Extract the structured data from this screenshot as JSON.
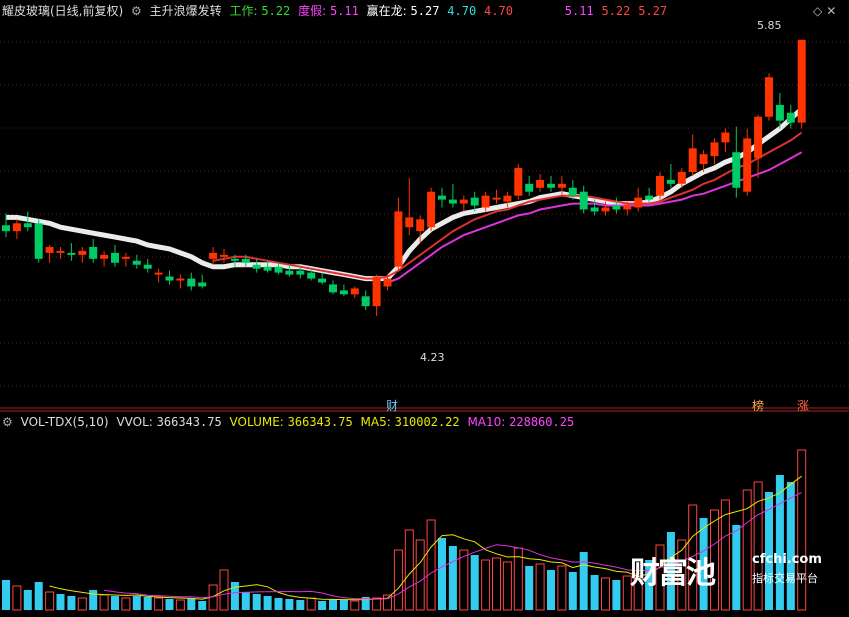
{
  "header": {
    "stock_name": "耀皮玻璃(日线,前复权)",
    "indicator_name": "主升浪爆发转",
    "gongzuo_label": "工作:",
    "gongzuo_value": "5.22",
    "duyi_label": "度假:",
    "duyi_value": "5.11",
    "yingzailong_label": "赢在龙:",
    "yingzailong_values": [
      "5.27",
      "4.70",
      "4.70"
    ],
    "extra_values": [
      "5.11",
      "5.22",
      "5.27"
    ]
  },
  "vol_header": {
    "indicator": "VOL-TDX(5,10)",
    "vvol_label": "VVOL:",
    "vvol_value": "366343.75",
    "volume_label": "VOLUME:",
    "volume_value": "366343.75",
    "ma5_label": "MA5:",
    "ma5_value": "310002.22",
    "ma10_label": "MA10:",
    "ma10_value": "228860.25"
  },
  "annotations": {
    "high_price": "5.85",
    "low_price": "4.23",
    "cai_marker": "财",
    "bang_marker": "榜",
    "zhang_marker": "涨"
  },
  "watermark": {
    "brand": "财富池",
    "site": "cfchi.com",
    "tagline": "指标交易平台"
  },
  "colors": {
    "up": "#ff3300",
    "down": "#00cc66",
    "ma_white": "#ffffff",
    "ma_red": "#e03030",
    "ma_magenta": "#dd33dd",
    "ma_yellow": "#e8e800",
    "vol_up": "#ff4444",
    "vol_down": "#33ccee",
    "bg": "#000000"
  },
  "chart_data": {
    "type": "candlestick",
    "y_range": [
      4.05,
      5.95
    ],
    "candles": [
      {
        "o": 4.91,
        "h": 4.97,
        "l": 4.85,
        "c": 4.88
      },
      {
        "o": 4.88,
        "h": 4.94,
        "l": 4.84,
        "c": 4.92
      },
      {
        "o": 4.92,
        "h": 4.98,
        "l": 4.88,
        "c": 4.9
      },
      {
        "o": 4.92,
        "h": 4.94,
        "l": 4.72,
        "c": 4.74
      },
      {
        "o": 4.77,
        "h": 4.81,
        "l": 4.72,
        "c": 4.8
      },
      {
        "o": 4.77,
        "h": 4.8,
        "l": 4.74,
        "c": 4.78
      },
      {
        "o": 4.77,
        "h": 4.82,
        "l": 4.73,
        "c": 4.76
      },
      {
        "o": 4.76,
        "h": 4.8,
        "l": 4.72,
        "c": 4.78
      },
      {
        "o": 4.8,
        "h": 4.84,
        "l": 4.72,
        "c": 4.74
      },
      {
        "o": 4.74,
        "h": 4.78,
        "l": 4.7,
        "c": 4.76
      },
      {
        "o": 4.77,
        "h": 4.81,
        "l": 4.7,
        "c": 4.72
      },
      {
        "o": 4.74,
        "h": 4.77,
        "l": 4.7,
        "c": 4.75
      },
      {
        "o": 4.73,
        "h": 4.76,
        "l": 4.69,
        "c": 4.71
      },
      {
        "o": 4.71,
        "h": 4.74,
        "l": 4.67,
        "c": 4.69
      },
      {
        "o": 4.66,
        "h": 4.69,
        "l": 4.62,
        "c": 4.67
      },
      {
        "o": 4.65,
        "h": 4.68,
        "l": 4.61,
        "c": 4.63
      },
      {
        "o": 4.63,
        "h": 4.66,
        "l": 4.59,
        "c": 4.64
      },
      {
        "o": 4.64,
        "h": 4.67,
        "l": 4.58,
        "c": 4.6
      },
      {
        "o": 4.62,
        "h": 4.66,
        "l": 4.59,
        "c": 4.6
      },
      {
        "o": 4.74,
        "h": 4.8,
        "l": 4.71,
        "c": 4.77
      },
      {
        "o": 4.75,
        "h": 4.79,
        "l": 4.72,
        "c": 4.76
      },
      {
        "o": 4.74,
        "h": 4.76,
        "l": 4.7,
        "c": 4.73
      },
      {
        "o": 4.74,
        "h": 4.76,
        "l": 4.7,
        "c": 4.72
      },
      {
        "o": 4.71,
        "h": 4.74,
        "l": 4.67,
        "c": 4.69
      },
      {
        "o": 4.7,
        "h": 4.73,
        "l": 4.67,
        "c": 4.68
      },
      {
        "o": 4.7,
        "h": 4.72,
        "l": 4.66,
        "c": 4.67
      },
      {
        "o": 4.68,
        "h": 4.71,
        "l": 4.65,
        "c": 4.66
      },
      {
        "o": 4.68,
        "h": 4.7,
        "l": 4.64,
        "c": 4.66
      },
      {
        "o": 4.67,
        "h": 4.69,
        "l": 4.63,
        "c": 4.64
      },
      {
        "o": 4.64,
        "h": 4.67,
        "l": 4.61,
        "c": 4.62
      },
      {
        "o": 4.61,
        "h": 4.63,
        "l": 4.56,
        "c": 4.57
      },
      {
        "o": 4.58,
        "h": 4.61,
        "l": 4.55,
        "c": 4.56
      },
      {
        "o": 4.56,
        "h": 4.6,
        "l": 4.54,
        "c": 4.59
      },
      {
        "o": 4.55,
        "h": 4.58,
        "l": 4.48,
        "c": 4.5
      },
      {
        "o": 4.5,
        "h": 4.66,
        "l": 4.45,
        "c": 4.65
      },
      {
        "o": 4.6,
        "h": 4.66,
        "l": 4.58,
        "c": 4.64
      },
      {
        "o": 4.7,
        "h": 5.05,
        "l": 4.68,
        "c": 4.98
      },
      {
        "o": 4.9,
        "h": 5.15,
        "l": 4.86,
        "c": 4.95
      },
      {
        "o": 4.88,
        "h": 4.96,
        "l": 4.82,
        "c": 4.94
      },
      {
        "o": 4.9,
        "h": 5.1,
        "l": 4.88,
        "c": 5.08
      },
      {
        "o": 5.06,
        "h": 5.1,
        "l": 5.0,
        "c": 5.04
      },
      {
        "o": 5.04,
        "h": 5.12,
        "l": 5.0,
        "c": 5.02
      },
      {
        "o": 5.02,
        "h": 5.06,
        "l": 4.98,
        "c": 5.04
      },
      {
        "o": 5.05,
        "h": 5.08,
        "l": 4.98,
        "c": 5.01
      },
      {
        "o": 5.0,
        "h": 5.08,
        "l": 4.98,
        "c": 5.06
      },
      {
        "o": 5.04,
        "h": 5.09,
        "l": 5.02,
        "c": 5.05
      },
      {
        "o": 5.03,
        "h": 5.08,
        "l": 5.0,
        "c": 5.06
      },
      {
        "o": 5.06,
        "h": 5.22,
        "l": 5.04,
        "c": 5.2
      },
      {
        "o": 5.12,
        "h": 5.16,
        "l": 5.06,
        "c": 5.08
      },
      {
        "o": 5.1,
        "h": 5.17,
        "l": 5.08,
        "c": 5.14
      },
      {
        "o": 5.12,
        "h": 5.16,
        "l": 5.08,
        "c": 5.1
      },
      {
        "o": 5.1,
        "h": 5.16,
        "l": 5.06,
        "c": 5.12
      },
      {
        "o": 5.1,
        "h": 5.14,
        "l": 5.04,
        "c": 5.06
      },
      {
        "o": 5.08,
        "h": 5.11,
        "l": 4.97,
        "c": 4.99
      },
      {
        "o": 5.0,
        "h": 5.04,
        "l": 4.96,
        "c": 4.98
      },
      {
        "o": 4.98,
        "h": 5.03,
        "l": 4.96,
        "c": 5.0
      },
      {
        "o": 5.01,
        "h": 5.05,
        "l": 4.97,
        "c": 4.99
      },
      {
        "o": 4.99,
        "h": 5.03,
        "l": 4.96,
        "c": 5.01
      },
      {
        "o": 5.0,
        "h": 5.1,
        "l": 4.98,
        "c": 5.05
      },
      {
        "o": 5.06,
        "h": 5.1,
        "l": 5.02,
        "c": 5.04
      },
      {
        "o": 5.06,
        "h": 5.18,
        "l": 5.04,
        "c": 5.16
      },
      {
        "o": 5.14,
        "h": 5.22,
        "l": 5.1,
        "c": 5.12
      },
      {
        "o": 5.12,
        "h": 5.2,
        "l": 5.1,
        "c": 5.18
      },
      {
        "o": 5.18,
        "h": 5.37,
        "l": 5.16,
        "c": 5.3
      },
      {
        "o": 5.22,
        "h": 5.29,
        "l": 5.18,
        "c": 5.27
      },
      {
        "o": 5.26,
        "h": 5.35,
        "l": 5.22,
        "c": 5.33
      },
      {
        "o": 5.33,
        "h": 5.4,
        "l": 5.28,
        "c": 5.38
      },
      {
        "o": 5.28,
        "h": 5.41,
        "l": 5.05,
        "c": 5.1
      },
      {
        "o": 5.08,
        "h": 5.4,
        "l": 5.06,
        "c": 5.35
      },
      {
        "o": 5.25,
        "h": 5.47,
        "l": 5.15,
        "c": 5.46
      },
      {
        "o": 5.46,
        "h": 5.68,
        "l": 5.44,
        "c": 5.66
      },
      {
        "o": 5.52,
        "h": 5.58,
        "l": 5.4,
        "c": 5.44
      },
      {
        "o": 5.48,
        "h": 5.52,
        "l": 5.4,
        "c": 5.43
      },
      {
        "o": 5.43,
        "h": 5.85,
        "l": 5.4,
        "c": 5.85
      }
    ],
    "ma_white": [
      4.95,
      4.95,
      4.94,
      4.93,
      4.92,
      4.9,
      4.89,
      4.88,
      4.87,
      4.86,
      4.85,
      4.84,
      4.83,
      4.81,
      4.8,
      4.79,
      4.77,
      4.75,
      4.72,
      4.7,
      4.7,
      4.71,
      4.71,
      4.71,
      4.71,
      4.71,
      4.7,
      4.7,
      4.69,
      4.68,
      4.67,
      4.66,
      4.65,
      4.64,
      4.64,
      4.64,
      4.7,
      4.78,
      4.84,
      4.89,
      4.92,
      4.95,
      4.97,
      4.98,
      4.99,
      5.0,
      5.01,
      5.02,
      5.03,
      5.05,
      5.06,
      5.07,
      5.06,
      5.05,
      5.04,
      5.03,
      5.02,
      5.02,
      5.02,
      5.03,
      5.05,
      5.08,
      5.12,
      5.15,
      5.18,
      5.2,
      5.23,
      5.25,
      5.28,
      5.32,
      5.36,
      5.4,
      5.45,
      5.5
    ],
    "ma_red": [
      null,
      null,
      null,
      null,
      null,
      null,
      null,
      null,
      null,
      null,
      null,
      null,
      null,
      null,
      null,
      null,
      null,
      null,
      null,
      4.73,
      4.74,
      4.75,
      4.75,
      4.74,
      4.73,
      4.72,
      4.71,
      4.7,
      4.69,
      4.68,
      4.67,
      4.66,
      4.65,
      4.64,
      4.64,
      4.65,
      4.68,
      4.72,
      4.76,
      4.8,
      4.84,
      4.88,
      4.91,
      4.94,
      4.96,
      4.98,
      4.99,
      5.01,
      5.03,
      5.04,
      5.05,
      5.06,
      5.06,
      5.06,
      5.05,
      5.04,
      5.03,
      5.02,
      5.02,
      5.02,
      5.03,
      5.05,
      5.07,
      5.09,
      5.12,
      5.14,
      5.17,
      5.2,
      5.22,
      5.25,
      5.28,
      5.31,
      5.34,
      5.38
    ],
    "ma_magenta": [
      null,
      null,
      null,
      null,
      null,
      null,
      null,
      null,
      null,
      null,
      null,
      null,
      null,
      null,
      null,
      null,
      null,
      null,
      null,
      null,
      null,
      null,
      null,
      null,
      null,
      null,
      null,
      null,
      null,
      null,
      null,
      null,
      null,
      null,
      null,
      4.62,
      4.64,
      4.68,
      4.72,
      4.76,
      4.8,
      4.83,
      4.86,
      4.88,
      4.9,
      4.92,
      4.94,
      4.96,
      4.97,
      4.99,
      5.0,
      5.01,
      5.02,
      5.02,
      5.02,
      5.01,
      5.01,
      5.01,
      5.01,
      5.01,
      5.02,
      5.03,
      5.04,
      5.06,
      5.07,
      5.09,
      5.11,
      5.13,
      5.15,
      5.17,
      5.19,
      5.22,
      5.25,
      5.28
    ],
    "volume": [
      30,
      24,
      20,
      28,
      18,
      16,
      14,
      12,
      20,
      15,
      14,
      12,
      14,
      13,
      12,
      11,
      10,
      12,
      9,
      25,
      40,
      28,
      18,
      16,
      14,
      12,
      11,
      10,
      12,
      9,
      11,
      10,
      9,
      13,
      12,
      15,
      60,
      80,
      70,
      90,
      72,
      64,
      60,
      55,
      50,
      52,
      48,
      62,
      44,
      46,
      40,
      44,
      38,
      58,
      35,
      32,
      30,
      34,
      36,
      50,
      65,
      78,
      70,
      105,
      92,
      100,
      110,
      85,
      120,
      128,
      118,
      135,
      128,
      160
    ],
    "volume_up": [
      false,
      true,
      false,
      false,
      true,
      false,
      false,
      true,
      false,
      true,
      false,
      true,
      false,
      false,
      true,
      false,
      true,
      false,
      false,
      true,
      true,
      false,
      false,
      false,
      false,
      false,
      false,
      false,
      true,
      false,
      false,
      false,
      true,
      false,
      true,
      true,
      true,
      true,
      true,
      true,
      false,
      false,
      true,
      false,
      true,
      true,
      true,
      true,
      false,
      true,
      false,
      true,
      false,
      false,
      false,
      true,
      false,
      true,
      true,
      false,
      true,
      false,
      true,
      true,
      false,
      true,
      true,
      false,
      true,
      true,
      false,
      false,
      false,
      true
    ],
    "vol_y_max": 180
  }
}
